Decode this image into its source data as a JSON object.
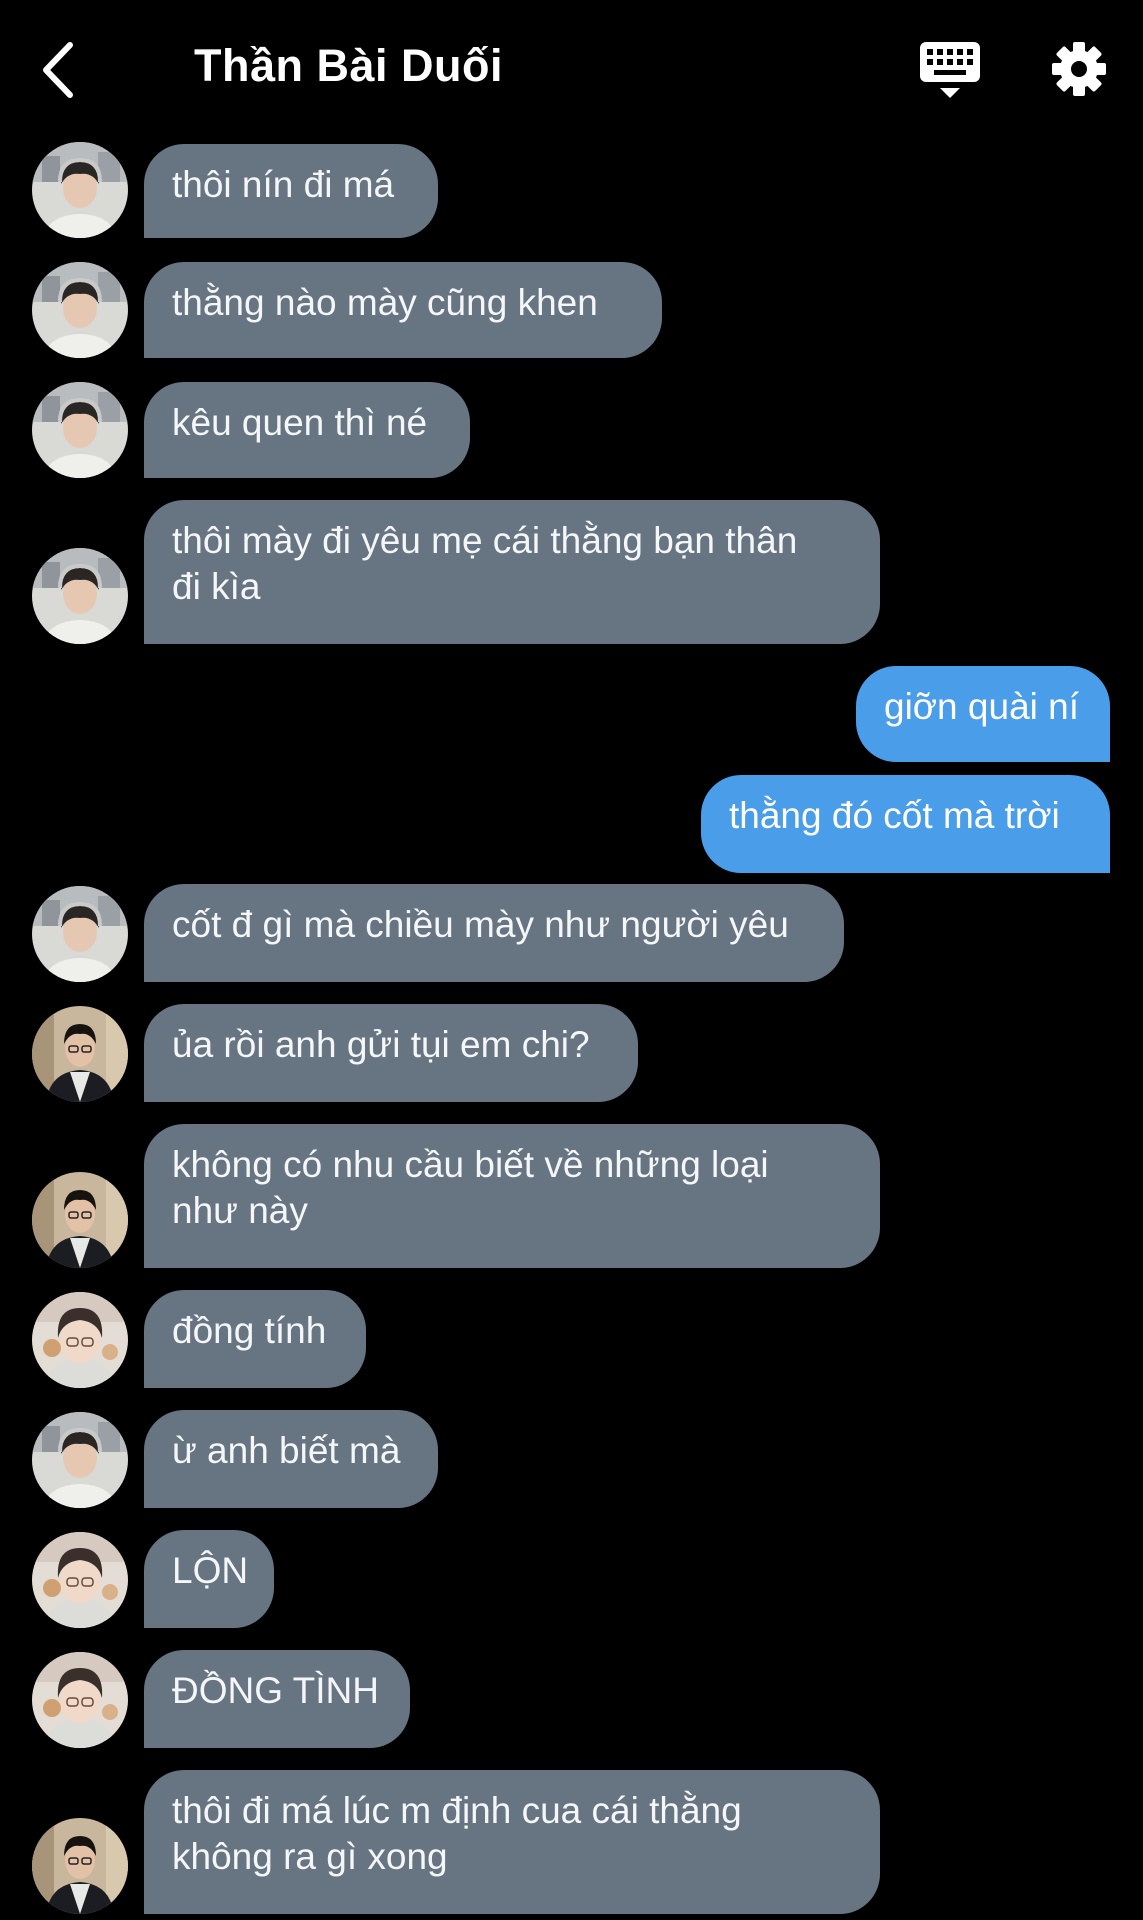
{
  "header": {
    "title": "Thần Bài Duối",
    "back_icon": "chevron-left-icon",
    "keyboard_icon": "keyboard-icon",
    "settings_icon": "gear-icon"
  },
  "colors": {
    "background": "#000000",
    "incoming_bubble": "#677481",
    "outgoing_bubble": "#4a9de8",
    "text": "#ffffff"
  },
  "messages": [
    {
      "side": "in",
      "avatar": "avatar-a",
      "text": "thôi nín đi má"
    },
    {
      "side": "in",
      "avatar": "avatar-a",
      "text": "thằng nào mày cũng khen"
    },
    {
      "side": "in",
      "avatar": "avatar-a",
      "text": "kêu quen thì né"
    },
    {
      "side": "in",
      "avatar": "avatar-a",
      "text": "thôi mày đi yêu mẹ cái thằng bạn thân\nđi kìa"
    },
    {
      "side": "out",
      "text": "giỡn quài ní"
    },
    {
      "side": "out",
      "text": "thằng đó cốt mà trời"
    },
    {
      "side": "in",
      "avatar": "avatar-a",
      "text": "cốt đ gì mà chiều mày như người yêu"
    },
    {
      "side": "in",
      "avatar": "avatar-b",
      "text": "ủa rồi anh gửi tụi em chi?"
    },
    {
      "side": "in",
      "avatar": "avatar-b",
      "text": "không có nhu cầu biết về những loại\nnhư này"
    },
    {
      "side": "in",
      "avatar": "avatar-c",
      "text": "đồng tính"
    },
    {
      "side": "in",
      "avatar": "avatar-a",
      "text": "ừ anh biết mà"
    },
    {
      "side": "in",
      "avatar": "avatar-c",
      "text": "LỘN"
    },
    {
      "side": "in",
      "avatar": "avatar-c",
      "text": "ĐỒNG TÌNH"
    },
    {
      "side": "in",
      "avatar": "avatar-b",
      "text": "thôi đi má lúc m định cua cái thằng\nkhông ra gì xong"
    }
  ]
}
